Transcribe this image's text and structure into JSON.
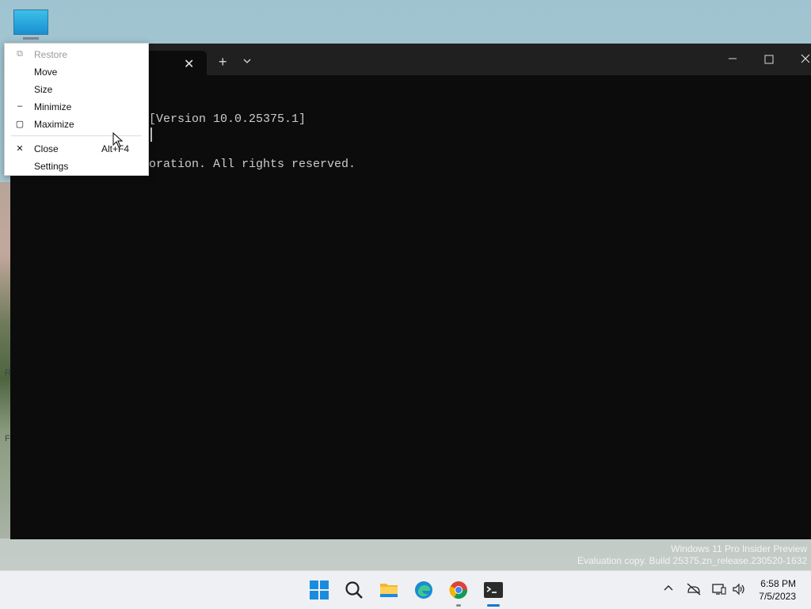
{
  "desktop": {
    "icon_name": "this-pc-icon",
    "left_fragments": [
      "R",
      "F"
    ]
  },
  "terminal": {
    "tab_close_icon": "close-icon",
    "new_tab_icon": "plus-icon",
    "dropdown_icon": "chevron-down-icon",
    "window_controls": [
      "minimize-icon",
      "maximize-icon",
      "close-icon"
    ],
    "console_lines": [
      "[Version 10.0.25375.1]",
      "oration. All rights reserved."
    ]
  },
  "system_menu": {
    "items": [
      {
        "label": "Restore",
        "icon": "restore-icon",
        "shortcut": "",
        "disabled": true
      },
      {
        "label": "Move",
        "icon": "",
        "shortcut": "",
        "disabled": false
      },
      {
        "label": "Size",
        "icon": "",
        "shortcut": "",
        "disabled": false
      },
      {
        "label": "Minimize",
        "icon": "minimize-icon",
        "shortcut": "",
        "disabled": false
      },
      {
        "label": "Maximize",
        "icon": "maximize-icon",
        "shortcut": "",
        "disabled": false
      },
      {
        "label": "Close",
        "icon": "close-icon",
        "shortcut": "Alt+F4",
        "disabled": false
      },
      {
        "label": "Settings",
        "icon": "",
        "shortcut": "",
        "disabled": false
      }
    ]
  },
  "watermark": {
    "line1": "Windows 11 Pro Insider Preview",
    "line2": "Evaluation copy. Build 25375.zn_release.230520-1632"
  },
  "taskbar": {
    "apps": [
      "start-icon",
      "search-icon",
      "file-explorer-icon",
      "edge-icon",
      "chrome-icon",
      "terminal-icon"
    ],
    "tray_icons": [
      "chevron-up-icon",
      "network-off-icon",
      "display-icon",
      "volume-icon"
    ],
    "time": "6:58 PM",
    "date": "7/5/2023"
  },
  "colors": {
    "terminal_bg": "#0c0c0c",
    "titlebar_bg": "#202020",
    "taskbar_bg": "#eef0f3",
    "accent": "#0a78d4"
  }
}
